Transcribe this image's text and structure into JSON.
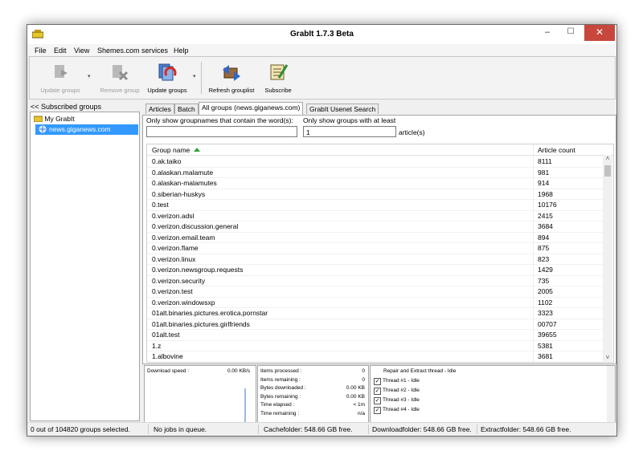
{
  "window": {
    "title": "GrabIt 1.7.3 Beta",
    "minimize": "–",
    "maximize": "☐",
    "close": "✕"
  },
  "menu": [
    "File",
    "Edit",
    "View",
    "Shemes.com services",
    "Help"
  ],
  "toolbar": {
    "update_groups": "Update groups",
    "remove_group": "Remove group",
    "update_groups2": "Update groups",
    "refresh_grouplist": "Refresh grouplist",
    "subscribe": "Subscribe",
    "dropdown_arrow": "▾"
  },
  "sidebar": {
    "header": "<< Subscribed groups",
    "root": "My GrabIt",
    "server": "news.giganews.com"
  },
  "tabs": [
    "Articles",
    "Batch",
    "All groups (news.giganews.com)",
    "GrabIt Usenet Search"
  ],
  "filters": {
    "name_label": "Only show groupnames that contain the word(s):",
    "name_value": "",
    "min_label": "Only show groups with at least",
    "min_value": "1",
    "min_suffix": "article(s)"
  },
  "grid": {
    "col_name": "Group name",
    "col_count": "Article count",
    "rows": [
      {
        "name": "0.ak.taiko",
        "count": "8111"
      },
      {
        "name": "0.alaskan.malamute",
        "count": "981"
      },
      {
        "name": "0.alaskan-malamutes",
        "count": "914"
      },
      {
        "name": "0.siberian-huskys",
        "count": "1968"
      },
      {
        "name": "0.test",
        "count": "10176"
      },
      {
        "name": "0.verizon.adsl",
        "count": "2415"
      },
      {
        "name": "0.verizon.discussion.general",
        "count": "3684"
      },
      {
        "name": "0.verizon.email.team",
        "count": "894"
      },
      {
        "name": "0.verizon.flame",
        "count": "875"
      },
      {
        "name": "0.verizon.linux",
        "count": "823"
      },
      {
        "name": "0.verizon.newsgroup.requests",
        "count": "1429"
      },
      {
        "name": "0.verizon.security",
        "count": "735"
      },
      {
        "name": "0.verizon.test",
        "count": "2005"
      },
      {
        "name": "0.verizon.windowsxp",
        "count": "1102"
      },
      {
        "name": "01alt.binaries.pictures.erotica.pornstar",
        "count": "3323"
      },
      {
        "name": "01alt.binaries.pictures.girlfriends",
        "count": "00707"
      },
      {
        "name": "01alt.test",
        "count": "39655"
      },
      {
        "name": "1.z",
        "count": "5381"
      },
      {
        "name": "1.albovine",
        "count": "3681"
      }
    ],
    "scroll_up": "˄",
    "scroll_down": "˅"
  },
  "stats": {
    "download_speed_label": "Download speed :",
    "download_speed_value": "0.00 KB/s",
    "rows": [
      {
        "label": "Items processed :",
        "value": "0"
      },
      {
        "label": "Items remaining :",
        "value": "0"
      },
      {
        "label": "Bytes downloaded :",
        "value": "0.00 KB"
      },
      {
        "label": "Bytes remaining :",
        "value": "0.00 KB"
      },
      {
        "label": "Time elapsed :",
        "value": "< 1m"
      },
      {
        "label": "Time remaining :",
        "value": "n/a"
      }
    ],
    "threads_header": "Repair and Extract thread - Idle",
    "threads": [
      "Thread #1 - Idle",
      "Thread #2 - Idle",
      "Thread #3 - Idle",
      "Thread #4 - Idle"
    ],
    "check": "✓"
  },
  "status": {
    "selected": "0 out of 104820 groups selected.",
    "jobs": "No jobs in queue.",
    "cache": "Cachefolder: 548.66 GB free.",
    "download": "Downloadfolder: 548.66 GB free.",
    "extract": "Extractfolder: 548.66 GB free."
  }
}
